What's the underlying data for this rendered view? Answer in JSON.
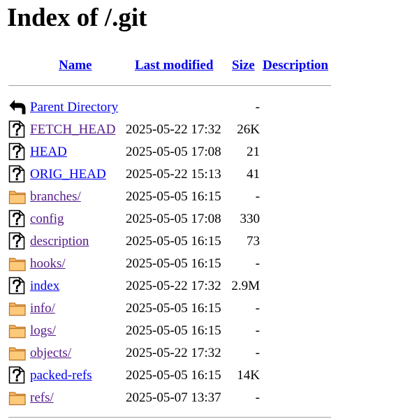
{
  "page": {
    "title": "Index of /.git"
  },
  "columns": {
    "name": "Name",
    "last_modified": "Last modified",
    "size": "Size",
    "description": "Description"
  },
  "colors": {
    "link": "#0000ee",
    "visited": "#551a8b",
    "rule": "#a0a0a0"
  },
  "entries": [
    {
      "icon": "back-icon",
      "name": "Parent Directory",
      "modified": "",
      "size": "-",
      "visited": false
    },
    {
      "icon": "unknown-file-icon",
      "name": "FETCH_HEAD",
      "modified": "2025-05-22 17:32",
      "size": "26K",
      "visited": true
    },
    {
      "icon": "unknown-file-icon",
      "name": "HEAD",
      "modified": "2025-05-05 17:08",
      "size": "21",
      "visited": false
    },
    {
      "icon": "unknown-file-icon",
      "name": "ORIG_HEAD",
      "modified": "2025-05-22 15:13",
      "size": "41",
      "visited": false
    },
    {
      "icon": "folder-icon",
      "name": "branches/",
      "modified": "2025-05-05 16:15",
      "size": "-",
      "visited": true
    },
    {
      "icon": "unknown-file-icon",
      "name": "config",
      "modified": "2025-05-05 17:08",
      "size": "330",
      "visited": true
    },
    {
      "icon": "unknown-file-icon",
      "name": "description",
      "modified": "2025-05-05 16:15",
      "size": "73",
      "visited": true
    },
    {
      "icon": "folder-icon",
      "name": "hooks/",
      "modified": "2025-05-05 16:15",
      "size": "-",
      "visited": true
    },
    {
      "icon": "unknown-file-icon",
      "name": "index",
      "modified": "2025-05-22 17:32",
      "size": "2.9M",
      "visited": false
    },
    {
      "icon": "folder-icon",
      "name": "info/",
      "modified": "2025-05-05 16:15",
      "size": "-",
      "visited": true
    },
    {
      "icon": "folder-icon",
      "name": "logs/",
      "modified": "2025-05-05 16:15",
      "size": "-",
      "visited": true
    },
    {
      "icon": "folder-icon",
      "name": "objects/",
      "modified": "2025-05-22 17:32",
      "size": "-",
      "visited": true
    },
    {
      "icon": "unknown-file-icon",
      "name": "packed-refs",
      "modified": "2025-05-05 16:15",
      "size": "14K",
      "visited": false
    },
    {
      "icon": "folder-icon",
      "name": "refs/",
      "modified": "2025-05-07 13:37",
      "size": "-",
      "visited": true
    }
  ]
}
